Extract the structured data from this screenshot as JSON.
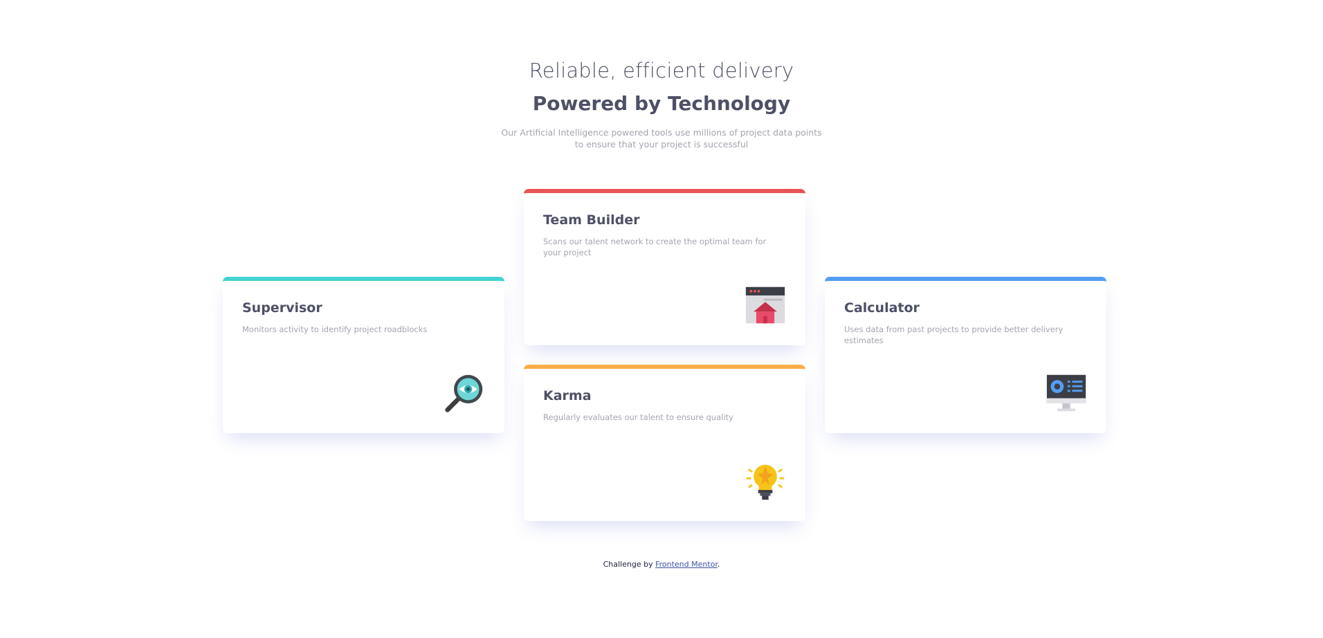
{
  "header": {
    "subtitle": "Reliable, efficient delivery",
    "title": "Powered by Technology",
    "intro": "Our Artificial Intelligence powered tools use millions of project data points to ensure that your project is successful"
  },
  "cards": [
    {
      "title": "Supervisor",
      "description": "Monitors activity to identify project roadblocks",
      "accent": "#44d3d2",
      "icon": "magnifier-eye-icon"
    },
    {
      "title": "Team Builder",
      "description": "Scans our talent network to create the optimal team for your project",
      "accent": "#ea5454",
      "icon": "browser-house-icon"
    },
    {
      "title": "Karma",
      "description": "Regularly evaluates our talent to ensure quality",
      "accent": "#fcae4a",
      "icon": "lightbulb-icon"
    },
    {
      "title": "Calculator",
      "description": "Uses data from past projects to provide better delivery estimates",
      "accent": "#549ef2",
      "icon": "monitor-dashboard-icon"
    }
  ],
  "attribution": {
    "prefix": "Challenge by",
    "link_text": "Frontend Mentor",
    "suffix": "."
  }
}
